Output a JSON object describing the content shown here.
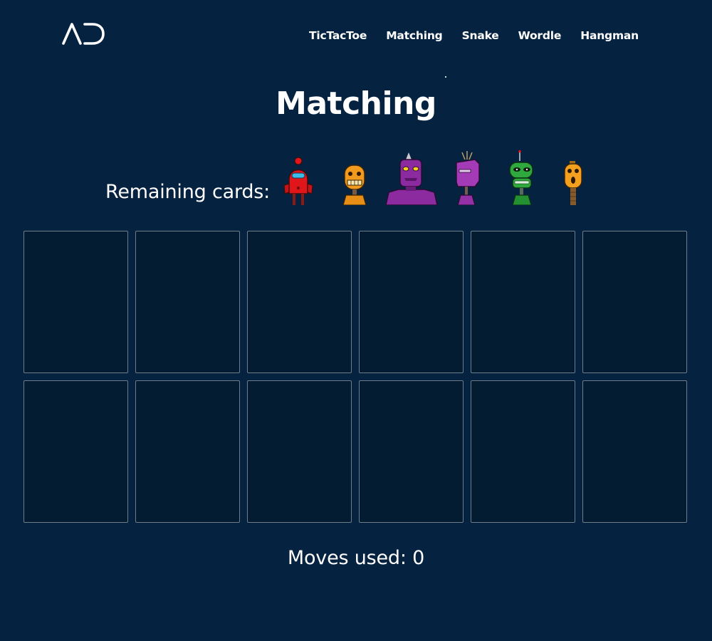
{
  "header": {
    "logo_icon": "ad-monogram-logo",
    "nav": [
      {
        "label": "TicTacToe"
      },
      {
        "label": "Matching"
      },
      {
        "label": "Snake"
      },
      {
        "label": "Wordle"
      },
      {
        "label": "Hangman"
      }
    ]
  },
  "game": {
    "title": "Matching",
    "remaining_label": "Remaining cards:",
    "remaining_cards": [
      {
        "icon": "red-robot-icon",
        "color": "#e0161b"
      },
      {
        "icon": "orange-robot-icon",
        "color": "#f29a1d"
      },
      {
        "icon": "purple-big-robot-icon",
        "color": "#8c2aa0"
      },
      {
        "icon": "purple-robot-icon",
        "color": "#a23bb5"
      },
      {
        "icon": "green-robot-icon",
        "color": "#2fa83d"
      },
      {
        "icon": "orange-small-robot-icon",
        "color": "#f3a021"
      }
    ],
    "card_count": 12,
    "moves_text": "Moves used: 0"
  },
  "colors": {
    "background": "#052240",
    "card_face_down": "#031c31",
    "card_border": "#6f7c89",
    "text": "#ffffff"
  }
}
